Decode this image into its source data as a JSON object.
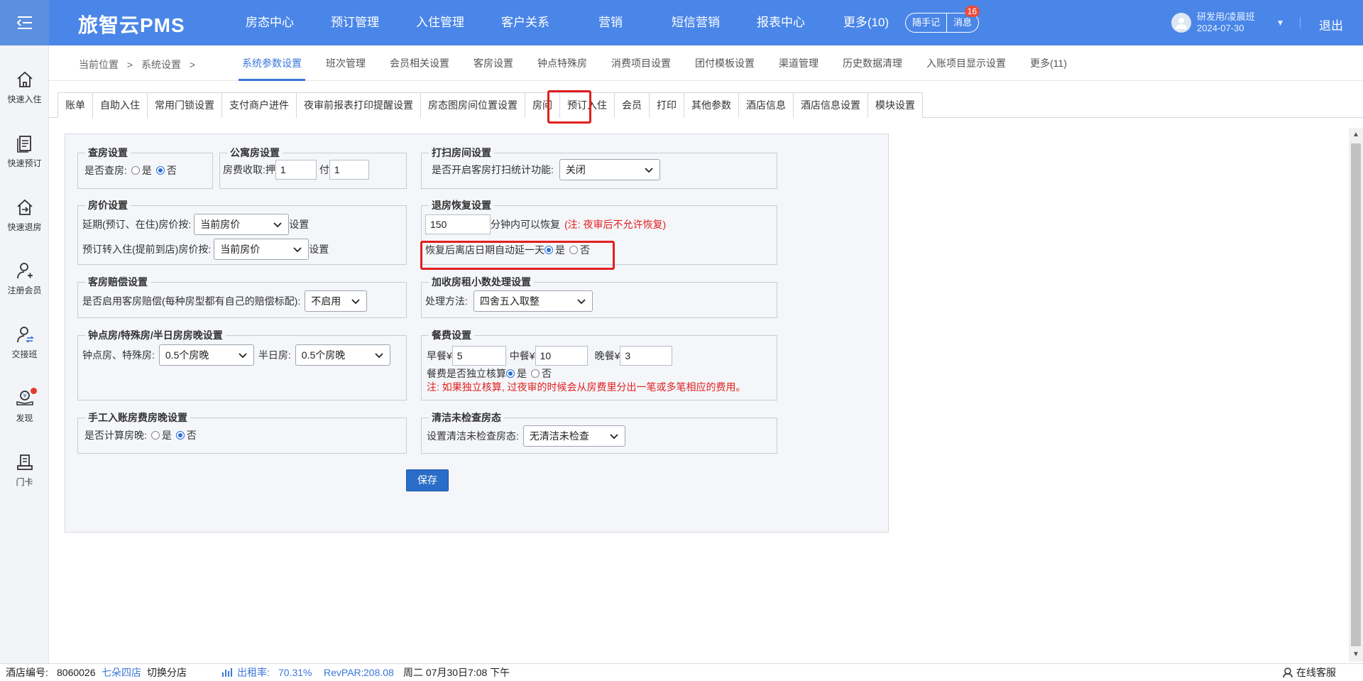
{
  "app": {
    "logo": "旅智云PMS"
  },
  "nav": [
    "房态中心",
    "预订管理",
    "入住管理",
    "客户关系",
    "营销",
    "短信营销",
    "报表中心",
    "更多(10)"
  ],
  "header": {
    "memo": "随手记",
    "messages": "消息",
    "message_count": "16",
    "user_name": "研发用/凌晨班",
    "user_date": "2024-07-30",
    "logout": "退出"
  },
  "sidebar": [
    {
      "label": "快速入住",
      "icon": "home-icon"
    },
    {
      "label": "快速预订",
      "icon": "clipboard-icon"
    },
    {
      "label": "快速退房",
      "icon": "checkout-icon"
    },
    {
      "label": "注册会员",
      "icon": "add-user-icon"
    },
    {
      "label": "交接班",
      "icon": "shift-icon"
    },
    {
      "label": "发现",
      "icon": "discover-icon"
    },
    {
      "label": "门卡",
      "icon": "card-icon"
    }
  ],
  "breadcrumb": {
    "current": "当前位置",
    "sep": ">",
    "section": "系统设置"
  },
  "top_tabs": [
    "系统参数设置",
    "班次管理",
    "会员相关设置",
    "客房设置",
    "钟点特殊房",
    "消费项目设置",
    "团付模板设置",
    "渠道管理",
    "历史数据清理",
    "入账项目显示设置",
    "更多(11)"
  ],
  "sub_tabs": [
    "账单",
    "自助入住",
    "常用门锁设置",
    "支付商户进件",
    "夜审前报表打印提醒设置",
    "房态图房间位置设置",
    "房间",
    "预订入住",
    "会员",
    "打印",
    "其他参数",
    "酒店信息",
    "酒店信息设置",
    "模块设置"
  ],
  "form": {
    "check_room": {
      "title": "查房设置",
      "label": "是否查房:",
      "yes": "是",
      "no": "否"
    },
    "apartment": {
      "title": "公寓房设置",
      "label": "房费收取:",
      "deposit_label": "押",
      "deposit_value": "1",
      "pay_label": "付",
      "pay_value": "1"
    },
    "cleaning": {
      "title": "打扫房间设置",
      "label": "是否开启客房打扫统计功能:",
      "value": "关闭"
    },
    "room_price": {
      "title": "房价设置",
      "row1_label": "延期(预订、在住)房价按:",
      "row1_value": "当前房价",
      "row1_suffix": "设置",
      "row2_label": "预订转入住(提前到店)房价按:",
      "row2_value": "当前房价",
      "row2_suffix": "设置"
    },
    "checkout_restore": {
      "title": "退房恢复设置",
      "minutes": "150",
      "minutes_suffix": "分钟内可以恢复",
      "note": "(注: 夜审后不允许恢复)",
      "extend_label": "恢复后离店日期自动延一天",
      "yes": "是",
      "no": "否"
    },
    "compensation": {
      "title": "客房赔偿设置",
      "label": "是否启用客房赔偿(每种房型都有自己的赔偿标配):",
      "value": "不启用"
    },
    "rounding": {
      "title": "加收房租小数处理设置",
      "label": "处理方法:",
      "value": "四舍五入取整"
    },
    "hourly": {
      "title": "钟点房/特殊房/半日房房晚设置",
      "label1": "钟点房、特殊房:",
      "value1": "0.5个房晚",
      "label2": "半日房:",
      "value2": "0.5个房晚"
    },
    "meals": {
      "title": "餐费设置",
      "breakfast_label": "早餐¥",
      "breakfast": "5",
      "lunch_label": "中餐¥",
      "lunch": "10",
      "dinner_label": "晚餐¥",
      "dinner": "3",
      "independent_label": "餐费是否独立核算",
      "yes": "是",
      "no": "否",
      "note": "注: 如果独立核算, 过夜审的时候会从房费里分出一笔或多笔相应的费用。"
    },
    "manual_posting": {
      "title": "手工入账房费房晚设置",
      "label": "是否计算房晚:",
      "yes": "是",
      "no": "否"
    },
    "clean_uninspected": {
      "title": "清洁未检查房态",
      "label": "设置清洁未检查房态:",
      "value": "无清洁未检查"
    },
    "save": "保存"
  },
  "statusbar": {
    "hotel_label": "酒店编号:",
    "hotel_no": "8060026",
    "hotel_name": "七朵四店",
    "switch": "切换分店",
    "occupancy_label": "出租率:",
    "occupancy": "70.31%",
    "revpar_label": "RevPAR:",
    "revpar": "208.08",
    "datetime": "周二 07月30日7:08 下午",
    "support": "在线客服"
  },
  "colors": {
    "primary": "#4a86e8",
    "active_tab": "#3a78d8",
    "highlight": "#e02020",
    "save_button": "#2a6dc9"
  }
}
